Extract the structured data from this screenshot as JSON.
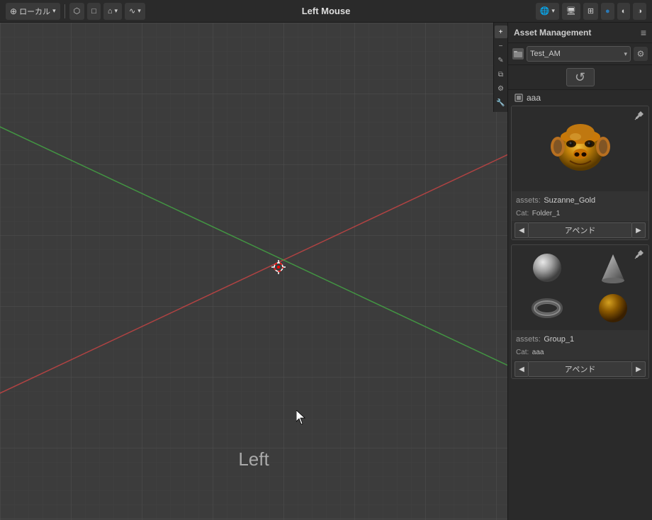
{
  "toolbar": {
    "mode_label": "ローカル",
    "title": "Left Mouse",
    "items": [
      {
        "label": "ローカル",
        "icon": "↕"
      },
      {
        "label": "⬡",
        "icon": ""
      },
      {
        "label": "□",
        "icon": ""
      },
      {
        "label": "⌂",
        "icon": ""
      },
      {
        "label": "∿",
        "icon": ""
      }
    ]
  },
  "panel": {
    "title": "Asset Management",
    "menu_icon": "≡",
    "library": {
      "icon": "📁",
      "name": "Test_AM",
      "gear_icon": "⚙"
    },
    "refresh_icon": "↺",
    "category_icon": "⊟",
    "category_name": "aaa",
    "cards": [
      {
        "id": "card1",
        "asset_label": "assets:",
        "asset_name": "Suzanne_Gold",
        "cat_label": "Cat:",
        "cat_name": "Folder_1",
        "nav_prev": "◀",
        "nav_label": "アペンド",
        "nav_next": "▶",
        "pin_icon": "📌"
      },
      {
        "id": "card2",
        "asset_label": "assets:",
        "asset_name": "Group_1",
        "cat_label": "Cat:",
        "cat_name": "aaa",
        "nav_prev": "◀",
        "nav_label": "アペンド",
        "nav_next": "▶",
        "pin_icon": "📌"
      }
    ]
  },
  "right_icons": [
    {
      "name": "plus-icon",
      "icon": "+"
    },
    {
      "name": "minus-icon",
      "icon": "−"
    },
    {
      "name": "brush-icon",
      "icon": "✎"
    },
    {
      "name": "link-icon",
      "icon": "🔗"
    },
    {
      "name": "gear-icon",
      "icon": "⚙"
    },
    {
      "name": "wrench-icon",
      "icon": "🔧"
    }
  ],
  "viewport": {
    "left_label": "Left",
    "cursor_label": "3D cursor"
  },
  "colors": {
    "accent_blue": "#2a7ab8",
    "bg_dark": "#2a2a2a",
    "bg_mid": "#3c3c3c",
    "text_light": "#ccc",
    "text_muted": "#999"
  }
}
